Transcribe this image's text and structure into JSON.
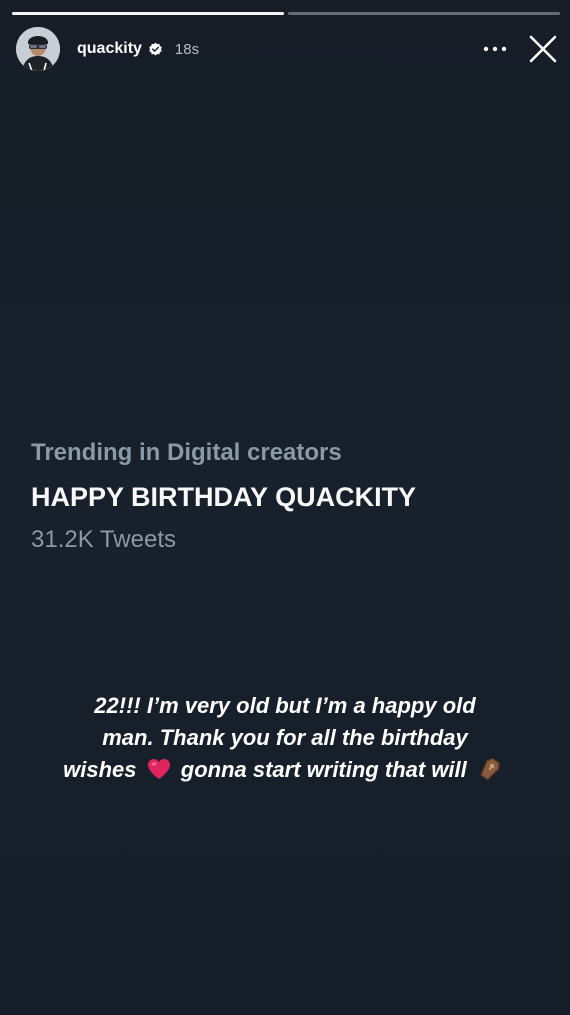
{
  "story": {
    "progress": [
      1.0,
      0.0
    ],
    "username": "quackity",
    "verified": true,
    "time": "18s",
    "more_icon": "ellipsis-icon",
    "close_icon": "close-icon"
  },
  "trend": {
    "context": "Trending in Digital creators",
    "name": "HAPPY BIRTHDAY QUACKITY",
    "count": "31.2K Tweets"
  },
  "caption": {
    "line1": "22!!! I’m very old but I’m a happy old",
    "line2": "man. Thank you for all the birthday",
    "line3_before": "wishes",
    "line3_after": "gonna start writing that will",
    "heart_emoji": "red-heart",
    "coffin_emoji": "coffin"
  },
  "colors": {
    "background": "#17202b",
    "trend_secondary": "#8b98a5",
    "trend_primary": "#f7f9f9",
    "heart": "#e0245e"
  }
}
